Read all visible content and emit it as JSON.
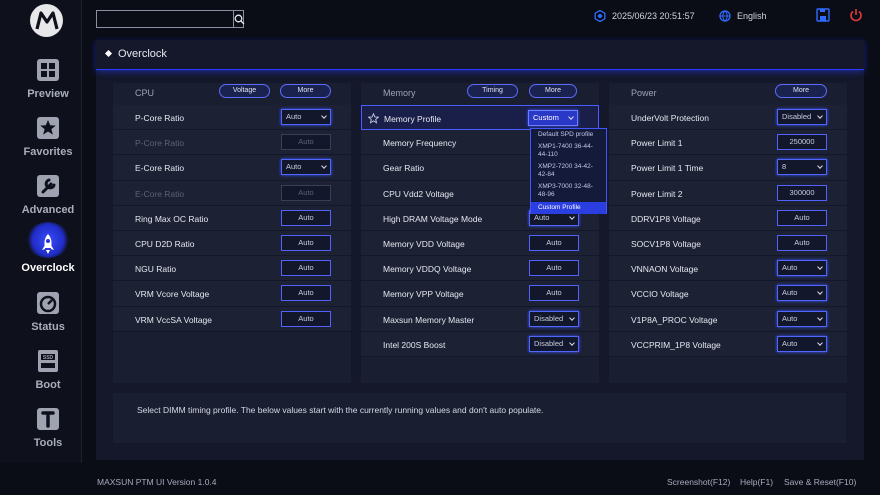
{
  "header": {
    "search_placeholder": "",
    "datetime": "2025/06/23 20:51:57",
    "language": "English"
  },
  "sidebar": {
    "items": [
      {
        "label": "Preview",
        "icon": "grid-icon"
      },
      {
        "label": "Favorites",
        "icon": "star-icon"
      },
      {
        "label": "Advanced",
        "icon": "wrench-icon"
      },
      {
        "label": "Overclock",
        "icon": "rocket-icon"
      },
      {
        "label": "Status",
        "icon": "gauge-icon"
      },
      {
        "label": "Boot",
        "icon": "ssd-icon"
      },
      {
        "label": "Tools",
        "icon": "tools-icon"
      }
    ],
    "active": "Overclock"
  },
  "page": {
    "title": "Overclock"
  },
  "cpu": {
    "title": "CPU",
    "voltage_btn": "Voltage",
    "more_btn": "More",
    "rows": [
      {
        "label": "P-Core Ratio",
        "value": "Auto",
        "kind": "dropdown",
        "disabled": false
      },
      {
        "label": "P-Core Ratio",
        "value": "Auto",
        "kind": "text",
        "disabled": true
      },
      {
        "label": "E-Core Ratio",
        "value": "Auto",
        "kind": "dropdown",
        "disabled": false
      },
      {
        "label": "E-Core Ratio",
        "value": "Auto",
        "kind": "text",
        "disabled": true
      },
      {
        "label": "Ring Max OC Ratio",
        "value": "Auto",
        "kind": "text",
        "disabled": false
      },
      {
        "label": "CPU D2D Ratio",
        "value": "Auto",
        "kind": "text",
        "disabled": false
      },
      {
        "label": "NGU Ratio",
        "value": "Auto",
        "kind": "text",
        "disabled": false
      },
      {
        "label": "VRM Vcore Voltage",
        "value": "Auto",
        "kind": "text",
        "disabled": false
      },
      {
        "label": "VRM VccSA Voltage",
        "value": "Auto",
        "kind": "text",
        "disabled": false
      }
    ]
  },
  "memory": {
    "title": "Memory",
    "timing_btn": "Timing",
    "more_btn": "More",
    "rows": [
      {
        "label": "Memory Profile",
        "value": "Custom",
        "kind": "dropdown"
      },
      {
        "label": "Memory Frequency",
        "value": "",
        "kind": "none"
      },
      {
        "label": "Gear Ratio",
        "value": "",
        "kind": "none"
      },
      {
        "label": "CPU Vdd2 Voltage",
        "value": "",
        "kind": "none"
      },
      {
        "label": "High DRAM Voltage Mode",
        "value": "Auto",
        "kind": "dropdown"
      },
      {
        "label": "Memory VDD Voltage",
        "value": "Auto",
        "kind": "text"
      },
      {
        "label": "Memory VDDQ Voltage",
        "value": "Auto",
        "kind": "text"
      },
      {
        "label": "Memory VPP Voltage",
        "value": "Auto",
        "kind": "text"
      },
      {
        "label": "Maxsun Memory Master",
        "value": "Disabled",
        "kind": "dropdown"
      },
      {
        "label": "Intel 200S Boost",
        "value": "Disabled",
        "kind": "dropdown"
      }
    ],
    "profile_options": [
      "Default SPD profile",
      "XMP1-7400 36-44-44-110",
      "XMP2-7200 34-42-42-84",
      "XMP3-7000 32-48-48-96",
      "Custom Profile"
    ]
  },
  "power": {
    "title": "Power",
    "more_btn": "More",
    "rows": [
      {
        "label": "UnderVolt Protection",
        "value": "Disabled",
        "kind": "dropdown"
      },
      {
        "label": "Power Limit 1",
        "value": "250000",
        "kind": "text"
      },
      {
        "label": "Power Limit 1 Time",
        "value": "8",
        "kind": "dropdown"
      },
      {
        "label": "Power Limit 2",
        "value": "300000",
        "kind": "text"
      },
      {
        "label": "DDRV1P8 Voltage",
        "value": "Auto",
        "kind": "text"
      },
      {
        "label": "SOCV1P8 Voltage",
        "value": "Auto",
        "kind": "text"
      },
      {
        "label": "VNNAON Voltage",
        "value": "Auto",
        "kind": "dropdown"
      },
      {
        "label": "VCCIO Voltage",
        "value": "Auto",
        "kind": "dropdown"
      },
      {
        "label": "V1P8A_PROC Voltage",
        "value": "Auto",
        "kind": "dropdown"
      },
      {
        "label": "VCCPRIM_1P8 Voltage",
        "value": "Auto",
        "kind": "dropdown"
      }
    ]
  },
  "help_text": "Select DIMM timing profile. The below values start with the currently running values and don't auto populate.",
  "footer": {
    "version": "MAXSUN PTM UI Version 1.0.4",
    "screenshot": "Screenshot(F12)",
    "help": "Help(F1)",
    "save": "Save & Reset(F10)"
  },
  "colors": {
    "accent": "#3c55ff",
    "background": "#0b0d16",
    "panel": "#191e30",
    "power_red": "#e23a3a"
  }
}
